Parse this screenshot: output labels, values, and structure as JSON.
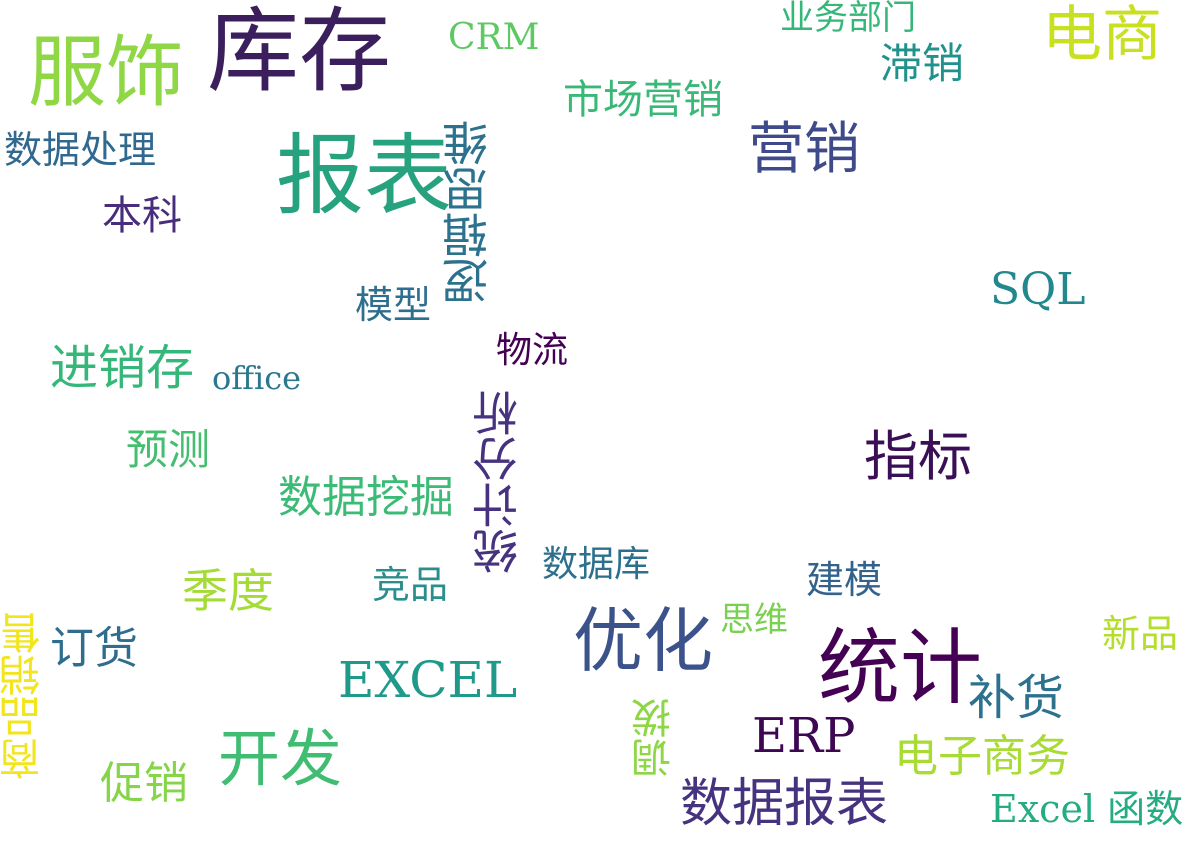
{
  "words": [
    {
      "text": "库存",
      "color": "#3b1f5c"
    },
    {
      "text": "服饰",
      "color": "#8fd744"
    },
    {
      "text": "CRM",
      "color": "#5ec962"
    },
    {
      "text": "业务部门",
      "color": "#35b779"
    },
    {
      "text": "电商",
      "color": "#c8e020"
    },
    {
      "text": "滞销",
      "color": "#21918c"
    },
    {
      "text": "市场营销",
      "color": "#3ab877"
    },
    {
      "text": "营销",
      "color": "#3e4a89"
    },
    {
      "text": "数据处理",
      "color": "#31688e"
    },
    {
      "text": "报表",
      "color": "#26a27f"
    },
    {
      "text": "逻辑思维",
      "color": "#2c718e"
    },
    {
      "text": "本科",
      "color": "#472d7b"
    },
    {
      "text": "SQL",
      "color": "#23888e"
    },
    {
      "text": "模型",
      "color": "#2e6e8e"
    },
    {
      "text": "进销存",
      "color": "#35b779"
    },
    {
      "text": "office",
      "color": "#2a788e"
    },
    {
      "text": "物流",
      "color": "#440154"
    },
    {
      "text": "统计分析",
      "color": "#46327e"
    },
    {
      "text": "预测",
      "color": "#45bf6f"
    },
    {
      "text": "指标",
      "color": "#3b0f56"
    },
    {
      "text": "数据挖掘",
      "color": "#3bbb75"
    },
    {
      "text": "数据库",
      "color": "#2d708e"
    },
    {
      "text": "季度",
      "color": "#a5db36"
    },
    {
      "text": "竞品",
      "color": "#2c8e8c"
    },
    {
      "text": "建模",
      "color": "#33638d"
    },
    {
      "text": "思维",
      "color": "#7ad151"
    },
    {
      "text": "新品",
      "color": "#b5de2b"
    },
    {
      "text": "商品销售",
      "color": "#f2e51d"
    },
    {
      "text": "订货",
      "color": "#2f6c8e"
    },
    {
      "text": "EXCEL",
      "color": "#1f9a8a"
    },
    {
      "text": "优化",
      "color": "#3b528b"
    },
    {
      "text": "统计",
      "color": "#440154"
    },
    {
      "text": "补货",
      "color": "#2c718e"
    },
    {
      "text": "调拨",
      "color": "#8ed645"
    },
    {
      "text": "ERP",
      "color": "#3e0751"
    },
    {
      "text": "开发",
      "color": "#40bd72"
    },
    {
      "text": "促销",
      "color": "#86d549"
    },
    {
      "text": "电子商务",
      "color": "#a8db34"
    },
    {
      "text": "数据报表",
      "color": "#46337f"
    },
    {
      "text": "Excel 函数",
      "color": "#25ac82"
    }
  ]
}
